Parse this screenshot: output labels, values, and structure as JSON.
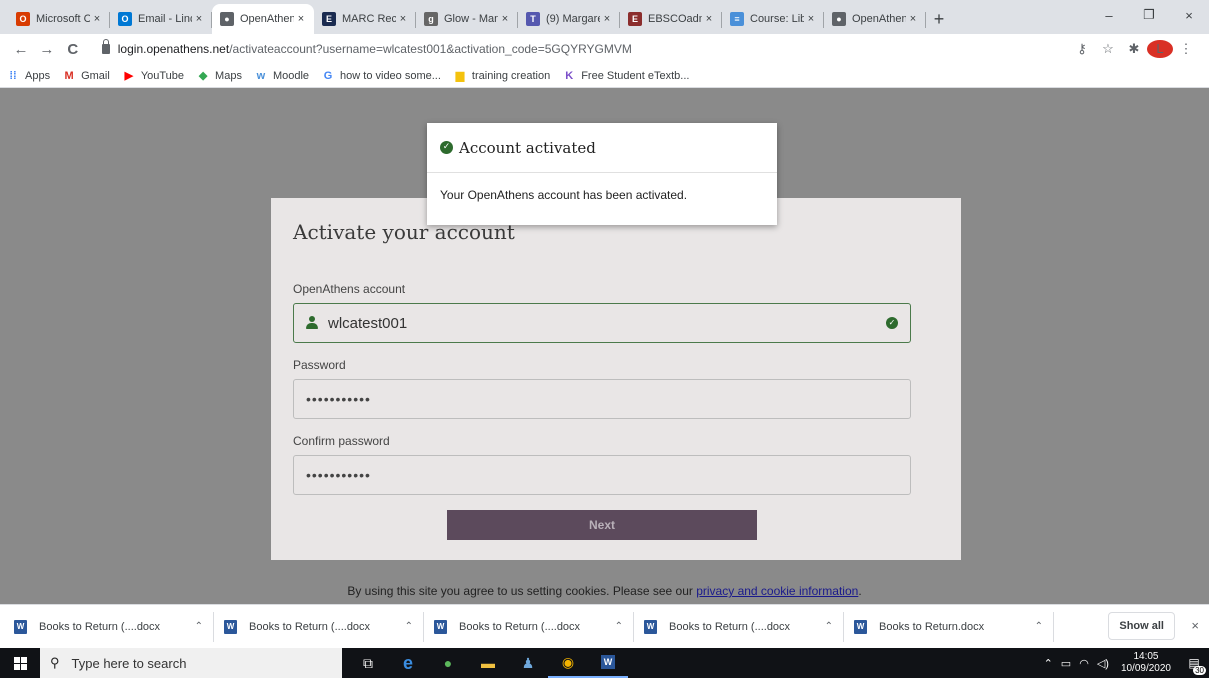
{
  "browser": {
    "tabs": [
      {
        "label": "Microsoft C",
        "icon": "office-icon",
        "color": "#d83b01",
        "glyph": "O"
      },
      {
        "label": "Email - Lind",
        "icon": "outlook-icon",
        "color": "#0078d4",
        "glyph": "O"
      },
      {
        "label": "OpenAthen",
        "icon": "globe-icon",
        "color": "#5f6368",
        "glyph": "●",
        "active": true
      },
      {
        "label": "MARC Reco",
        "icon": "e-icon",
        "color": "#1a2b50",
        "glyph": "E"
      },
      {
        "label": "Glow - Man",
        "icon": "glow-icon",
        "color": "#666666",
        "glyph": "g"
      },
      {
        "label": "(9) Margare",
        "icon": "teams-icon",
        "color": "#5558af",
        "glyph": "T"
      },
      {
        "label": "EBSCOadm",
        "icon": "ebsco-icon",
        "color": "#8b2d2d",
        "glyph": "E"
      },
      {
        "label": "Course: Libr",
        "icon": "moodle-icon",
        "color": "#4a90d9",
        "glyph": "≡"
      },
      {
        "label": "OpenAthen",
        "icon": "globe-icon",
        "color": "#5f6368",
        "glyph": "●"
      }
    ],
    "tab_close": "×",
    "new_tab": "+",
    "window_controls": {
      "minimize": "–",
      "restore": "❐",
      "close": "×"
    },
    "nav": {
      "back": "←",
      "forward": "→",
      "reload": "C"
    },
    "url_host": "login.openathens.net",
    "url_rest": "/activateaccount?username=wlcatest001&activation_code=5GQYRYGMVM",
    "toolbar_icons": {
      "key": "⚷",
      "star": "☆",
      "puzzle": "✱",
      "avatar": "L",
      "menu": "⋮"
    },
    "bookmarks": [
      {
        "label": "Apps",
        "icon": "apps-icon",
        "glyph": "⁞⁞",
        "color": "#4285f4"
      },
      {
        "label": "Gmail",
        "icon": "gmail-icon",
        "glyph": "M",
        "color": "#d93025"
      },
      {
        "label": "YouTube",
        "icon": "youtube-icon",
        "glyph": "▶",
        "color": "#ff0000"
      },
      {
        "label": "Maps",
        "icon": "maps-icon",
        "glyph": "◆",
        "color": "#34a853"
      },
      {
        "label": "Moodle",
        "icon": "moodle-icon",
        "glyph": "w",
        "color": "#4a90d9"
      },
      {
        "label": "how to video some...",
        "icon": "google-icon",
        "glyph": "G",
        "color": "#4285f4"
      },
      {
        "label": "training creation",
        "icon": "folder-icon",
        "glyph": "▆",
        "color": "#f4c20d"
      },
      {
        "label": "Free Student eTextb...",
        "icon": "k-icon",
        "glyph": "K",
        "color": "#7b4fc9"
      }
    ]
  },
  "page": {
    "heading": "Activate your account",
    "account_label": "OpenAthens account",
    "account_value": "wlcatest001",
    "password_label": "Password",
    "password_value": "•••••••••••",
    "confirm_label": "Confirm password",
    "confirm_value": "•••••••••••",
    "next_label": "Next",
    "cookie_text": "By using this site you agree to us setting cookies. Please see our ",
    "cookie_link": "privacy and cookie information",
    "cookie_end": ".",
    "modal_title": "Account activated",
    "modal_body": "Your OpenAthens account has been activated."
  },
  "downloads": {
    "items": [
      "Books to Return (....docx",
      "Books to Return (....docx",
      "Books to Return (....docx",
      "Books to Return (....docx",
      "Books to Return.docx"
    ],
    "show_all": "Show all",
    "close": "×"
  },
  "taskbar": {
    "search_placeholder": "Type here to search",
    "time": "14:05",
    "date": "10/09/2020",
    "notifications": "30"
  }
}
